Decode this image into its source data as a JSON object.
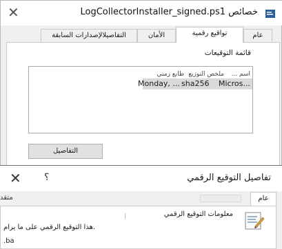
{
  "window": {
    "title": "LogCollectorInstaller_signed.ps1 خصائص"
  },
  "tabs": [
    "عام",
    "تواقيع رقمية",
    "الأمان",
    "التفاصيل",
    "الإصدارات السابقة"
  ],
  "signature_list": {
    "group_label": "قائمة التوقيعات",
    "headers": {
      "name": "اسم ...",
      "digest": "ملخص التوزيع",
      "timestamp": "طابع زمني"
    },
    "rows": [
      {
        "name": "Micros...",
        "digest": "sha256",
        "timestamp": "Monday, ..."
      }
    ]
  },
  "details_button": "التفاصيل",
  "dialog": {
    "title": "تفاصيل التوقيع الرقمي",
    "help": "؟",
    "tab_general": "عام",
    "tab_left_fragment": "متقد",
    "info_title": "معلومات التوقيع الرقمي",
    "info_line": "هذا التوقيع الرقمي على ما يرام.",
    "info_line2": ".ba"
  }
}
